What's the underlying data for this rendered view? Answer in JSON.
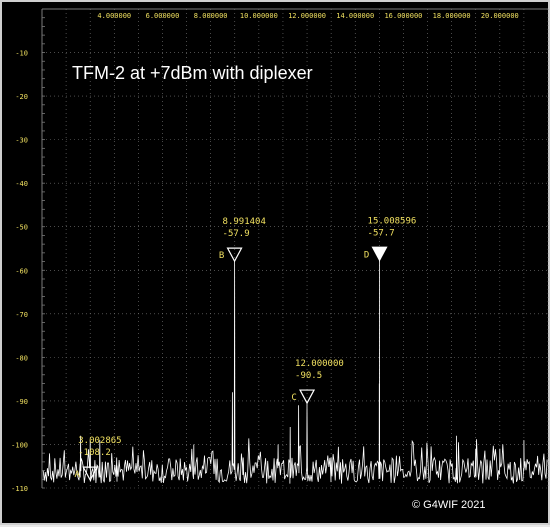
{
  "chart_data": {
    "type": "line",
    "title": "TFM-2 at +7dBm with diplexer",
    "copyright": "© G4WIF 2021",
    "xlim": [
      1.0,
      22.0
    ],
    "ylim": [
      -110,
      0
    ],
    "x_tick_labels": [
      "4.000000",
      "6.000000",
      "8.000000",
      "10.000000",
      "12.000000",
      "14.000000",
      "16.000000",
      "18.000000",
      "20.000000"
    ],
    "x_ticks": [
      4,
      6,
      8,
      10,
      12,
      14,
      16,
      18,
      20
    ],
    "y_tick_labels": [
      "-10",
      "-20",
      "-30",
      "-40",
      "-50",
      "-60",
      "-70",
      "-80",
      "-90",
      "-100",
      "-110"
    ],
    "y_ticks": [
      -10,
      -20,
      -30,
      -40,
      -50,
      -60,
      -70,
      "-80",
      -90,
      -100,
      -110
    ],
    "grid": true,
    "noise_floor_dbm": -106,
    "spurs": [
      {
        "x": 2.6,
        "y": -98
      },
      {
        "x": 3.0,
        "y": -99
      },
      {
        "x": 3.4,
        "y": -99
      },
      {
        "x": 4.1,
        "y": -103
      },
      {
        "x": 7.3,
        "y": -100
      },
      {
        "x": 8.9,
        "y": -88
      },
      {
        "x": 8.991404,
        "y": -57.9
      },
      {
        "x": 9.35,
        "y": -103
      },
      {
        "x": 10.8,
        "y": -100
      },
      {
        "x": 11.3,
        "y": -96
      },
      {
        "x": 11.65,
        "y": -91
      },
      {
        "x": 12.0,
        "y": -90.5
      },
      {
        "x": 13.0,
        "y": -103
      },
      {
        "x": 15.0,
        "y": -86
      },
      {
        "x": 15.008596,
        "y": -57.7
      },
      {
        "x": 18.2,
        "y": -98
      },
      {
        "x": 19.0,
        "y": -101
      },
      {
        "x": 20.0,
        "y": -101
      },
      {
        "x": 21.0,
        "y": -99
      }
    ],
    "markers": [
      {
        "id": "A",
        "x": 3.002865,
        "y": -108.2,
        "freq_label": "3.002865",
        "level_label": "-108.2",
        "filled": false
      },
      {
        "id": "B",
        "x": 8.991404,
        "y": -57.9,
        "freq_label": "8.991404",
        "level_label": "-57.9",
        "filled": false
      },
      {
        "id": "C",
        "x": 12.0,
        "y": -90.5,
        "freq_label": "12.000000",
        "level_label": "-90.5",
        "filled": false
      },
      {
        "id": "D",
        "x": 15.008596,
        "y": -57.7,
        "freq_label": "15.008596",
        "level_label": "-57.7",
        "filled": true
      }
    ],
    "colors": {
      "background": "#000000",
      "trace": "#ffffff",
      "grid": "#7a7a7a",
      "tick_labels": "#f0e060",
      "marker_text": "#f0e060"
    }
  }
}
